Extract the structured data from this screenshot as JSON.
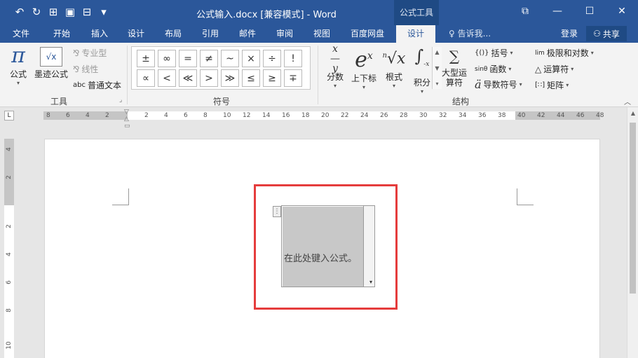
{
  "titlebar": {
    "title": "公式输入.docx [兼容模式] - Word",
    "context_tab": "公式工具",
    "qat": {
      "undo": "↶",
      "redo": "↻",
      "touch": "⊞",
      "save": "▣",
      "format": "⊟",
      "customize": "▾"
    },
    "min": "—",
    "restore": "☐",
    "close": "✕",
    "ribbon_display": "⧉"
  },
  "tabs": {
    "file": "文件",
    "home": "开始",
    "insert": "插入",
    "design1": "设计",
    "layout": "布局",
    "references": "引用",
    "mailings": "邮件",
    "review": "审阅",
    "view": "视图",
    "baidu": "百度网盘",
    "design2": "设计"
  },
  "tellme": {
    "icon": "♀",
    "label": "告诉我..."
  },
  "login": "登录",
  "share": {
    "icon": "⚇",
    "label": "共享"
  },
  "tools": {
    "equation": "公式",
    "ink": "墨迹公式",
    "professional": "专业型",
    "linear": "线性",
    "normal_text": "普通文本",
    "abc": "abc",
    "group": "工具",
    "launcher": "⌟"
  },
  "symbols": {
    "row1": [
      "±",
      "∞",
      "=",
      "≠",
      "~",
      "×",
      "÷",
      "!"
    ],
    "row2": [
      "∝",
      "<",
      "≪",
      ">",
      "≫",
      "≤",
      "≥",
      "∓"
    ],
    "group": "符号"
  },
  "structures": {
    "fraction": "分数",
    "script": "上下标",
    "radical": "根式",
    "integral": "积分",
    "large_op": "大型运算符",
    "bracket": "括号",
    "function": "函数",
    "accent": "导数符号",
    "limit": "极限和对数",
    "operator": "运算符",
    "matrix": "矩阵",
    "group": "结构",
    "bracket_icon": "{()}",
    "function_icon": "sinθ",
    "accent_icon": "ä",
    "limit_icon": "lim",
    "operator_icon": "△",
    "matrix_icon": "[∷]"
  },
  "ruler": {
    "left": [
      "8",
      "6",
      "4",
      "2"
    ],
    "right": [
      "2",
      "4",
      "6",
      "8",
      "10",
      "12",
      "14",
      "16",
      "18",
      "20",
      "22",
      "24",
      "26",
      "28",
      "30",
      "32",
      "34",
      "36",
      "38",
      "40",
      "42",
      "44",
      "46",
      "48"
    ]
  },
  "vruler": [
    "4",
    "2",
    "2",
    "4",
    "6",
    "8",
    "10"
  ],
  "document": {
    "placeholder": "在此处键入公式。",
    "handle": "⋮",
    "dropdown": "▾"
  },
  "colors": {
    "accent": "#2b579a",
    "highlight": "#e53c3c"
  }
}
